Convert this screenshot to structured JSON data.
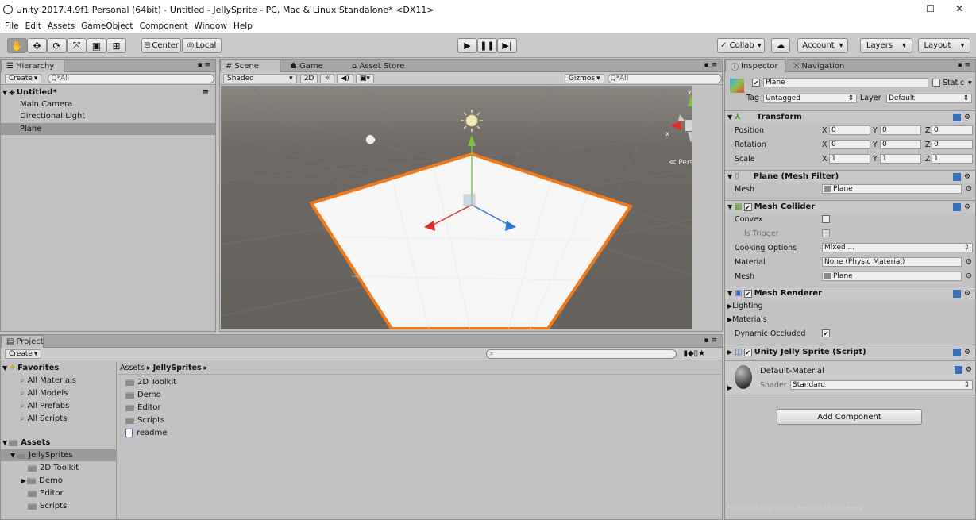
{
  "window": {
    "title": "Unity 2017.4.9f1 Personal (64bit) - Untitled - JellySprite - PC, Mac & Linux Standalone* <DX11>"
  },
  "menu": [
    "File",
    "Edit",
    "Assets",
    "GameObject",
    "Component",
    "Window",
    "Help"
  ],
  "toolbar": {
    "pivot": "Center",
    "space": "Local",
    "collab": "Collab",
    "account": "Account",
    "layers": "Layers",
    "layout": "Layout"
  },
  "hierarchy": {
    "tab": "Hierarchy",
    "create": "Create",
    "search_placeholder": "Q*All",
    "scene_name": "Untitled*",
    "items": [
      "Main Camera",
      "Directional Light",
      "Plane"
    ]
  },
  "scene": {
    "tabs": [
      "Scene",
      "Game",
      "Asset Store"
    ],
    "shading": "Shaded",
    "mode_2d": "2D",
    "gizmos": "Gizmos",
    "search_placeholder": "Q*All",
    "persp": "Persp",
    "axis": {
      "x": "x",
      "y": "y",
      "z": "z"
    }
  },
  "project": {
    "tab": "Project",
    "create": "Create",
    "favorites_title": "Favorites",
    "favorites": [
      "All Materials",
      "All Models",
      "All Prefabs",
      "All Scripts"
    ],
    "assets_title": "Assets",
    "tree": [
      "JellySprites",
      "2D Toolkit",
      "Demo",
      "Editor",
      "Scripts"
    ],
    "breadcrumb": [
      "Assets",
      "JellySprites"
    ],
    "files": [
      "2D Toolkit",
      "Demo",
      "Editor",
      "Scripts",
      "readme"
    ]
  },
  "inspector": {
    "tabs": [
      "Inspector",
      "Navigation"
    ],
    "object_name": "Plane",
    "static_label": "Static",
    "tag_label": "Tag",
    "tag_value": "Untagged",
    "layer_label": "Layer",
    "layer_value": "Default",
    "transform": {
      "title": "Transform",
      "rows": [
        {
          "label": "Position",
          "x": "0",
          "y": "0",
          "z": "0"
        },
        {
          "label": "Rotation",
          "x": "0",
          "y": "0",
          "z": "0"
        },
        {
          "label": "Scale",
          "x": "1",
          "y": "1",
          "z": "1"
        }
      ],
      "axes": [
        "X",
        "Y",
        "Z"
      ]
    },
    "mesh_filter": {
      "title": "Plane (Mesh Filter)",
      "mesh_label": "Mesh",
      "mesh_value": "Plane"
    },
    "mesh_collider": {
      "title": "Mesh Collider",
      "convex": "Convex",
      "is_trigger": "Is Trigger",
      "cooking_label": "Cooking Options",
      "cooking_value": "Mixed ...",
      "material_label": "Material",
      "material_value": "None (Physic Material)",
      "mesh_label": "Mesh",
      "mesh_value": "Plane"
    },
    "mesh_renderer": {
      "title": "Mesh Renderer",
      "lighting": "Lighting",
      "materials": "Materials",
      "dynamic_occluded": "Dynamic Occluded"
    },
    "script": {
      "title": "Unity Jelly Sprite (Script)"
    },
    "material": {
      "name": "Default-Material",
      "shader_label": "Shader",
      "shader_value": "Standard"
    },
    "add_component": "Add Component"
  },
  "watermark": "https://blog.csdn.net/cadaspheres",
  "colors": {
    "scene_bg": "#6b6661",
    "selection": "#f07a1a",
    "panel": "#c2c2c2"
  }
}
